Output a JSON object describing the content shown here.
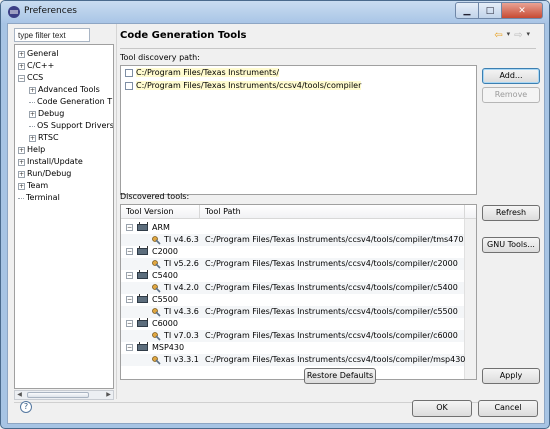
{
  "window": {
    "title": "Preferences",
    "controls": {
      "minimize": "▁",
      "maximize": "□",
      "close": "✕"
    }
  },
  "sidebar": {
    "filter_value": "type filter text",
    "items": [
      {
        "label": "General",
        "toggle": "+"
      },
      {
        "label": "C/C++",
        "toggle": "+"
      },
      {
        "label": "CCS",
        "toggle": "−"
      },
      {
        "label": "Advanced Tools",
        "toggle": "+"
      },
      {
        "label": "Code Generation T",
        "toggle": ""
      },
      {
        "label": "Debug",
        "toggle": "+"
      },
      {
        "label": "OS Support Drivers",
        "toggle": ""
      },
      {
        "label": "RTSC",
        "toggle": "+"
      },
      {
        "label": "Help",
        "toggle": "+"
      },
      {
        "label": "Install/Update",
        "toggle": "+"
      },
      {
        "label": "Run/Debug",
        "toggle": "+"
      },
      {
        "label": "Team",
        "toggle": "+"
      },
      {
        "label": "Terminal",
        "toggle": ""
      }
    ]
  },
  "page": {
    "title": "Code Generation Tools",
    "nav": {
      "back": "⇦",
      "forward": "⇨",
      "dropdown": "▾"
    }
  },
  "discovery": {
    "label": "Tool discovery path:",
    "paths": [
      "C:/Program Files/Texas Instruments/",
      "C:/Program Files/Texas Instruments/ccsv4/tools/compiler"
    ],
    "add_label": "Add...",
    "remove_label": "Remove"
  },
  "discovered": {
    "label": "Discovered tools:",
    "columns": {
      "version": "Tool Version",
      "path": "Tool Path"
    },
    "groups": [
      {
        "family": "ARM",
        "version": "TI v4.6.3",
        "path": "C:/Program Files/Texas Instruments/ccsv4/tools/compiler/tms470"
      },
      {
        "family": "C2000",
        "version": "TI v5.2.6",
        "path": "C:/Program Files/Texas Instruments/ccsv4/tools/compiler/c2000"
      },
      {
        "family": "C5400",
        "version": "TI v4.2.0",
        "path": "C:/Program Files/Texas Instruments/ccsv4/tools/compiler/c5400"
      },
      {
        "family": "C5500",
        "version": "TI v4.3.6",
        "path": "C:/Program Files/Texas Instruments/ccsv4/tools/compiler/c5500"
      },
      {
        "family": "C6000",
        "version": "TI v7.0.3",
        "path": "C:/Program Files/Texas Instruments/ccsv4/tools/compiler/c6000"
      },
      {
        "family": "MSP430",
        "version": "TI v3.3.1",
        "path": "C:/Program Files/Texas Instruments/ccsv4/tools/compiler/msp430"
      }
    ],
    "refresh_label": "Refresh",
    "gnu_label": "GNU Tools..."
  },
  "actions": {
    "restore_defaults": "Restore Defaults",
    "apply": "Apply",
    "ok": "OK",
    "cancel": "Cancel",
    "help": "?"
  }
}
